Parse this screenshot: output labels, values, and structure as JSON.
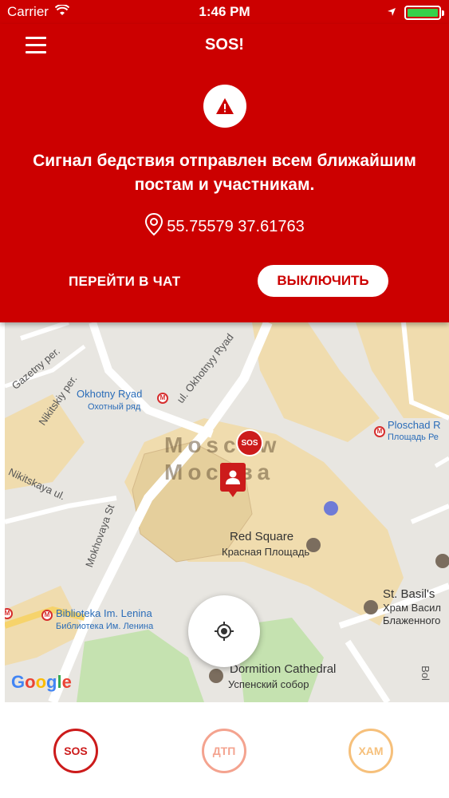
{
  "status_bar": {
    "carrier": "Carrier",
    "time": "1:46 PM"
  },
  "header": {
    "title": "SOS!"
  },
  "alert": {
    "message": "Сигнал бедствия отправлен всем ближайшим постам и участникам.",
    "coordinates": "55.75579 37.61763",
    "chat_button": "ПЕРЕЙТИ В ЧАТ",
    "off_button": "ВЫКЛЮЧИТЬ"
  },
  "map": {
    "labels": {
      "okhotny_en": "Okhotny Ryad",
      "okhotny_ru": "Охотный ряд",
      "ploschad_en": "Ploschad R",
      "ploschad_ru": "Площадь Ре",
      "moscow_en": "Moscow",
      "moscow_ru": "Москва",
      "red_square_en": "Red Square",
      "red_square_ru": "Красная Площадь",
      "biblioteka_en": "Biblioteka Im. Lenina",
      "biblioteka_ru": "Библиотека Им. Ленина",
      "st_basil_en": "St. Basil's",
      "st_basil_ru1": "Храм Васил",
      "st_basil_ru2": "Блаженного",
      "dormition_en": "Dormition Cathedral",
      "dormition_ru": "Успенский собор",
      "street_gazetny": "Gazetny per.",
      "street_nikitsky": "Nikitskiy per.",
      "street_okhotny": "ul. Okhotnyy Ryad",
      "street_mokhovaya": "Mokhovaya St",
      "street_nikitskaya": "Nikitskaya ul.",
      "street_bol": "Bol"
    },
    "pin_sos": "SOS",
    "metro_symbol": "M",
    "google": "Google"
  },
  "tabs": [
    {
      "label": "SOS"
    },
    {
      "label": "ДТП"
    },
    {
      "label": "ХАМ"
    }
  ]
}
